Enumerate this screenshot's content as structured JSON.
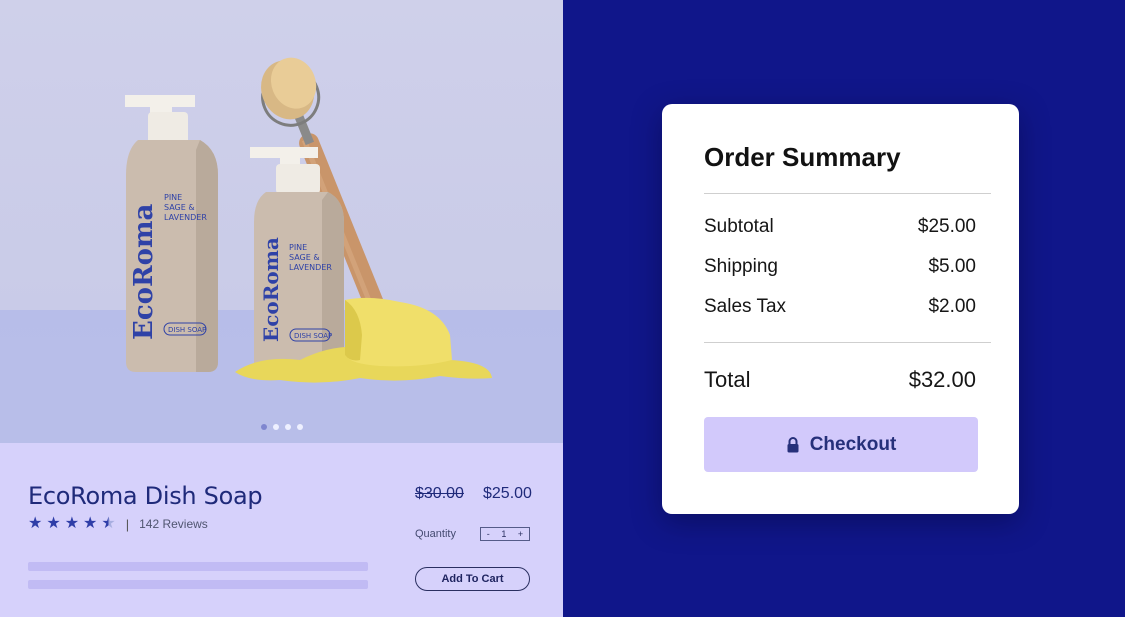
{
  "product": {
    "brand": "EcoRoma",
    "bottle_labels": {
      "scent": [
        "PINE",
        "SAGE &",
        "LAVENDER"
      ],
      "type": "DISH SOAP"
    },
    "name": "EcoRoma Dish Soap",
    "rating_value": 4.5,
    "rating_max": 5,
    "rating_separator": "|",
    "reviews": "142 Reviews",
    "old_price": "$30.00",
    "price": "$25.00",
    "quantity_label": "Quantity",
    "quantity_minus": "-",
    "quantity_value": "1",
    "quantity_plus": "+",
    "add_to_cart": "Add To Cart",
    "carousel": {
      "count": 4,
      "active_index": 0
    }
  },
  "summary": {
    "title": "Order Summary",
    "rows": [
      {
        "label": "Subtotal",
        "value": "$25.00"
      },
      {
        "label": "Shipping",
        "value": "$5.00"
      },
      {
        "label": "Sales Tax",
        "value": "$2.00"
      }
    ],
    "total_label": "Total",
    "total_value": "$32.00",
    "checkout_label": "Checkout",
    "checkout_icon": "lock-icon"
  },
  "colors": {
    "background": "#10168a",
    "product_panel": "#d6d1fb",
    "accent_text": "#1f2a7a",
    "checkout_button": "#d2c9fb"
  }
}
